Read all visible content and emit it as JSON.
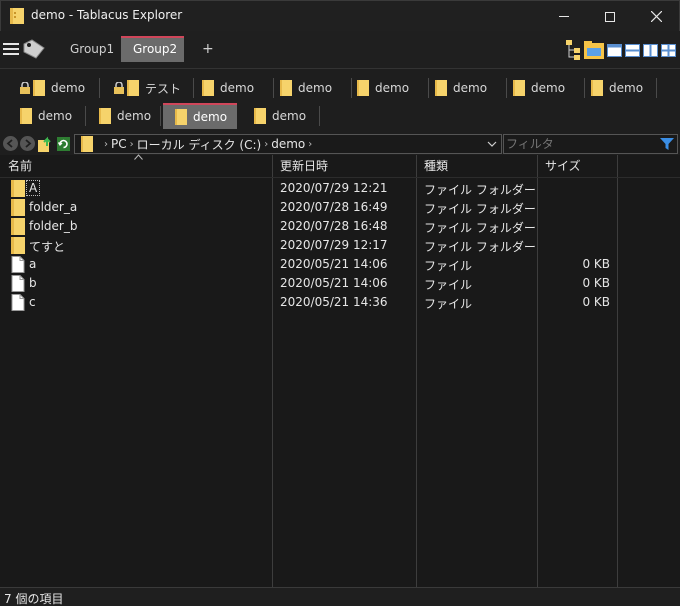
{
  "window": {
    "title": "demo - Tablacus Explorer",
    "buttons": [
      "minimize",
      "maximize",
      "close"
    ]
  },
  "groups": {
    "tabs": [
      {
        "label": "Group1",
        "active": false
      },
      {
        "label": "Group2",
        "active": true
      }
    ],
    "add_label": "+"
  },
  "tabs_row1": [
    {
      "label": "demo",
      "locked": true
    },
    {
      "label": "テスト",
      "locked": true
    },
    {
      "label": "demo",
      "locked": false
    },
    {
      "label": "demo",
      "locked": false
    },
    {
      "label": "demo",
      "locked": false
    },
    {
      "label": "demo",
      "locked": false
    },
    {
      "label": "demo",
      "locked": false
    },
    {
      "label": "demo",
      "locked": false
    }
  ],
  "tabs_row2": [
    {
      "label": "demo",
      "active": false
    },
    {
      "label": "demo",
      "active": false
    },
    {
      "label": "demo",
      "active": true
    },
    {
      "label": "demo",
      "active": false
    }
  ],
  "address": {
    "crumbs": [
      "PC",
      "ローカル ディスク (C:)",
      "demo"
    ]
  },
  "filter": {
    "placeholder": "フィルタ"
  },
  "columns": {
    "name": "名前",
    "date": "更新日時",
    "type": "種類",
    "size": "サイズ"
  },
  "files": [
    {
      "name": "A",
      "date": "2020/07/29 12:21",
      "type": "ファイル フォルダー",
      "size": "",
      "kind": "folder"
    },
    {
      "name": "folder_a",
      "date": "2020/07/28 16:49",
      "type": "ファイル フォルダー",
      "size": "",
      "kind": "folder"
    },
    {
      "name": "folder_b",
      "date": "2020/07/28 16:48",
      "type": "ファイル フォルダー",
      "size": "",
      "kind": "folder"
    },
    {
      "name": "てすと",
      "date": "2020/07/29 12:17",
      "type": "ファイル フォルダー",
      "size": "",
      "kind": "folder"
    },
    {
      "name": "a",
      "date": "2020/05/21 14:06",
      "type": "ファイル",
      "size": "0 KB",
      "kind": "file"
    },
    {
      "name": "b",
      "date": "2020/05/21 14:06",
      "type": "ファイル",
      "size": "0 KB",
      "kind": "file"
    },
    {
      "name": "c",
      "date": "2020/05/21 14:36",
      "type": "ファイル",
      "size": "0 KB",
      "kind": "file"
    }
  ],
  "status": {
    "text": "7 個の項目"
  },
  "colors": {
    "folder": "#f6d36b",
    "active_tab_accent": "#d0465a",
    "active_tab_bg": "#6b6b6b"
  }
}
